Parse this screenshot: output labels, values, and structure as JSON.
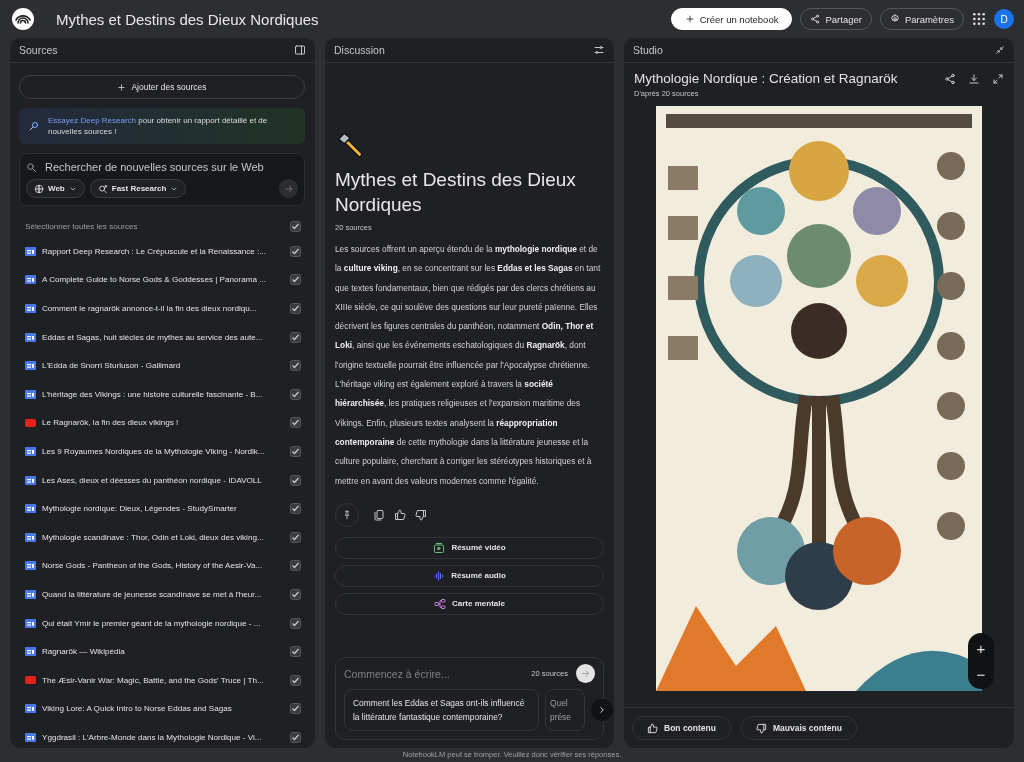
{
  "top_bar": {
    "title": "Mythes et Destins des Dieux Nordiques",
    "buttons": [
      {
        "label": "Créer un notebook",
        "kind": "primary"
      },
      {
        "label": "Partager",
        "kind": "share"
      },
      {
        "label": "Paramètres",
        "kind": "settings"
      }
    ],
    "avatar": "D"
  },
  "sources": {
    "title": "Sources",
    "add_button": "Ajouter des sources",
    "banner": {
      "link": "Essayez Deep Research",
      "text": " pour obtenir un rapport détaillé et de nouvelles sources !"
    },
    "search": {
      "placeholder": "Rechercher de nouvelles sources sur le Web",
      "chips": [
        "Web",
        "Fast Research"
      ]
    },
    "select_all": {
      "label": "Sélectionner toutes les sources",
      "checked": true
    },
    "items": [
      {
        "title": "Rapport Deep Research : Le Crépuscule et la Renaissance :...",
        "kind": "web",
        "checked": true
      },
      {
        "title": "A Complete Guide to Norse Gods & Goddesses | Panorama ...",
        "kind": "web",
        "checked": true
      },
      {
        "title": "Comment le ragnarök annonce-t-il la fin des dieux nordiqu...",
        "kind": "web",
        "checked": true
      },
      {
        "title": "Eddas et Sagas, huit siècles de mythes au service des aute...",
        "kind": "web",
        "checked": true
      },
      {
        "title": "L'Edda de Snorri Sturluson - Gallimard",
        "kind": "web",
        "checked": true
      },
      {
        "title": "L'héritage des Vikings : une histoire culturelle fascinante - B...",
        "kind": "web",
        "checked": true
      },
      {
        "title": "Le Ragnarök, la fin des dieux vikings !",
        "kind": "video",
        "checked": true
      },
      {
        "title": "Les 9 Royaumes Nordiques de la Mythologie Viking - Nordik...",
        "kind": "web",
        "checked": true
      },
      {
        "title": "Les Ases, dieux et déesses du panthéon nordique - IDAVOLL",
        "kind": "web",
        "checked": true
      },
      {
        "title": "Mythologie nordique: Dieux, Légendes - StudySmarter",
        "kind": "web",
        "checked": true
      },
      {
        "title": "Mythologie scandinave : Thor, Odin et Loki, dieux des viking...",
        "kind": "web",
        "checked": true
      },
      {
        "title": "Norse Gods - Pantheon of the Gods, History of the Aesir-Va...",
        "kind": "web",
        "checked": true
      },
      {
        "title": "Quand la littérature de jeunesse scandinave se met à l'heur...",
        "kind": "web",
        "checked": true
      },
      {
        "title": "Qui était Ymir le premier géant de la mythologie nordique - ...",
        "kind": "web",
        "checked": true
      },
      {
        "title": "Ragnarök — Wikipédia",
        "kind": "web",
        "checked": true
      },
      {
        "title": "The Æsir-Vanir War: Magic, Battle, and the Gods' Truce | Th...",
        "kind": "video",
        "checked": true
      },
      {
        "title": "Viking Lore: A Quick Intro to Norse Eddas and Sagas",
        "kind": "web",
        "checked": true
      },
      {
        "title": "Yggdrasil : L'Arbre-Monde dans la Mythologie Nordique - Vi...",
        "kind": "web",
        "checked": true
      }
    ]
  },
  "discussion": {
    "title": "Discussion",
    "notebook_title": "Mythes et Destins des Dieux Nordiques",
    "source_count": "20 sources",
    "summary": "Les sources offrent un aperçu étendu de la **mythologie nordique** et de la **culture viking**, en se concentrant sur les **Eddas et les Sagas** en tant que textes fondamentaux, bien que rédigés par des clercs chrétiens au XIIIe siècle, ce qui soulève des questions sur leur pureté païenne. Elles décrivent les figures centrales du panthéon, notamment **Odin, Thor et Loki**, ainsi que les événements eschatologiques du **Ragnarök**, dont l'origine textuelle pourrait être influencée par l'Apocalypse chrétienne. L'héritage viking est également exploré à travers la **société hiérarchisée**, les pratiques religieuses et l'expansion maritime des Vikings. Enfin, plusieurs textes analysent la **réappropriation contemporaine** de cette mythologie dans la littérature jeunesse et la culture populaire, cherchant à corriger les stéréotypes historiques et à mettre en avant des valeurs modernes comme l'égalité.",
    "actions": [
      {
        "label": "Résumé vidéo",
        "kind": "video"
      },
      {
        "label": "Résumé audio",
        "kind": "audio"
      },
      {
        "label": "Carte mentale",
        "kind": "mindmap"
      }
    ],
    "composer": {
      "placeholder": "Commencez à écrire...",
      "source_count": "20 sources"
    },
    "suggestions": [
      "Comment les Eddas et Sagas ont-ils influencé la littérature fantastique contemporaine?",
      "Quel prése"
    ]
  },
  "studio": {
    "title": "Studio",
    "artifact_title": "Mythologie Nordique : Création et Ragnarök",
    "subtitle": "D'après 20 sources",
    "zoom_in": "+",
    "zoom_out": "−",
    "feedback": [
      {
        "label": "Bon contenu",
        "kind": "good"
      },
      {
        "label": "Mauvais contenu",
        "kind": "bad"
      }
    ]
  },
  "footer": "NotebookLM peut se tromper. Veuillez donc vérifier ses réponses."
}
